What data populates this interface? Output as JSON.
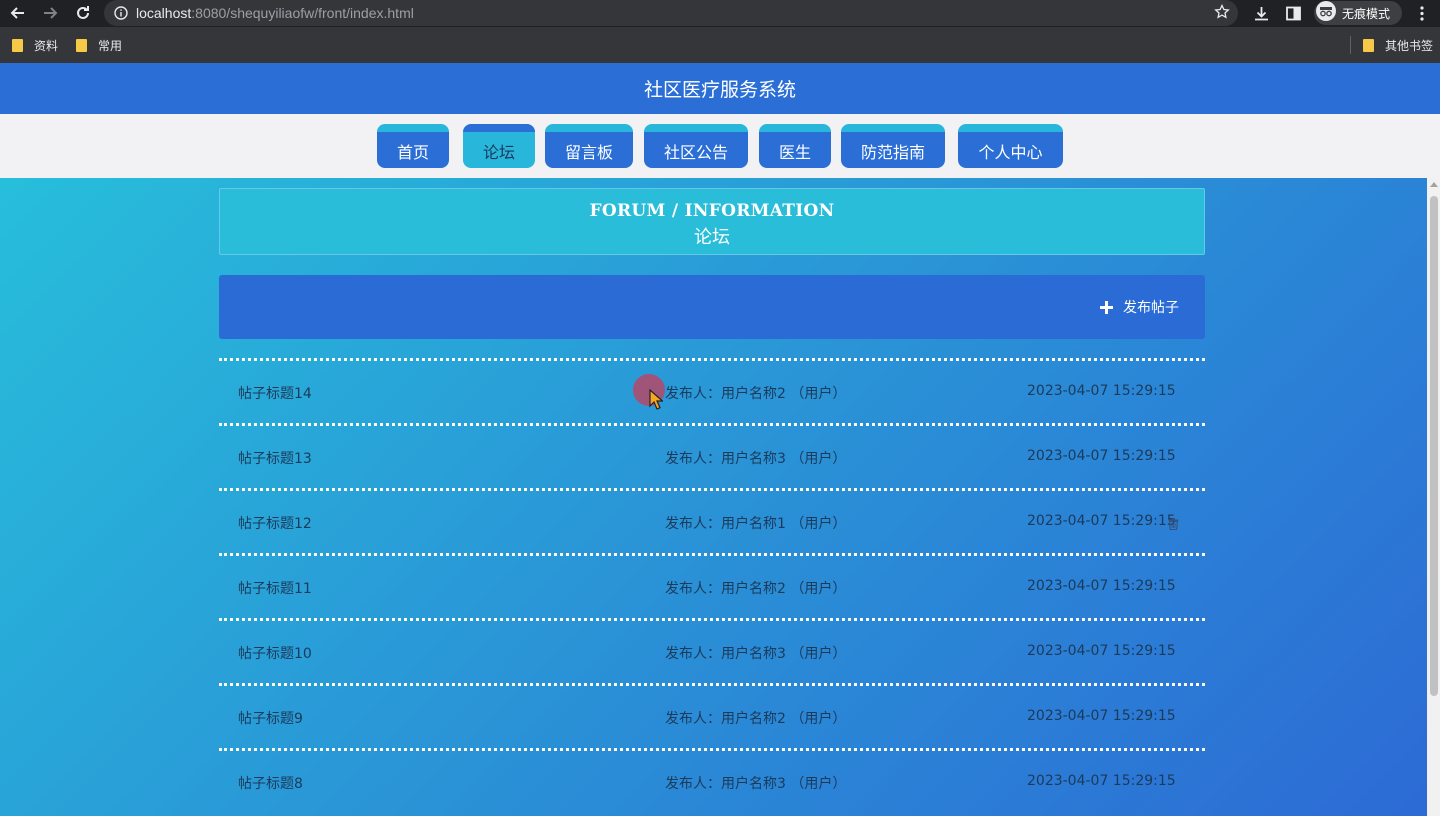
{
  "browser": {
    "url_host": "localhost",
    "url_rest": ":8080/shequyiliaofw/front/index.html",
    "incognito_label": "无痕模式",
    "bookmarks": [
      {
        "label": "资料"
      },
      {
        "label": "常用"
      }
    ],
    "other_bookmarks": "其他书签"
  },
  "site": {
    "title": "社区医疗服务系统",
    "menu": [
      {
        "label": "首页",
        "active": false
      },
      {
        "label": "论坛",
        "active": true
      },
      {
        "label": "留言板",
        "active": false
      },
      {
        "label": "社区公告",
        "active": false
      },
      {
        "label": "医生",
        "active": false
      },
      {
        "label": "防范指南",
        "active": false
      },
      {
        "label": "个人中心",
        "active": false
      }
    ]
  },
  "banner": {
    "en": "FORUM / INFORMATION",
    "cn": "论坛"
  },
  "actions": {
    "post_label": "发布帖子"
  },
  "posts": [
    {
      "title": "帖子标题14",
      "author": "发布人：用户名称2 （用户）",
      "time": "2023-04-07 15:29:15"
    },
    {
      "title": "帖子标题13",
      "author": "发布人：用户名称3 （用户）",
      "time": "2023-04-07 15:29:15"
    },
    {
      "title": "帖子标题12",
      "author": "发布人：用户名称1 （用户）",
      "time": "2023-04-07 15:29:15"
    },
    {
      "title": "帖子标题11",
      "author": "发布人：用户名称2 （用户）",
      "time": "2023-04-07 15:29:15"
    },
    {
      "title": "帖子标题10",
      "author": "发布人：用户名称3 （用户）",
      "time": "2023-04-07 15:29:15"
    },
    {
      "title": "帖子标题9",
      "author": "发布人：用户名称2 （用户）",
      "time": "2023-04-07 15:29:15"
    },
    {
      "title": "帖子标题8",
      "author": "发布人：用户名称3 （用户）",
      "time": "2023-04-07 15:29:15"
    }
  ],
  "colors": {
    "primary": "#2b6fd6",
    "accent": "#29b6db"
  }
}
